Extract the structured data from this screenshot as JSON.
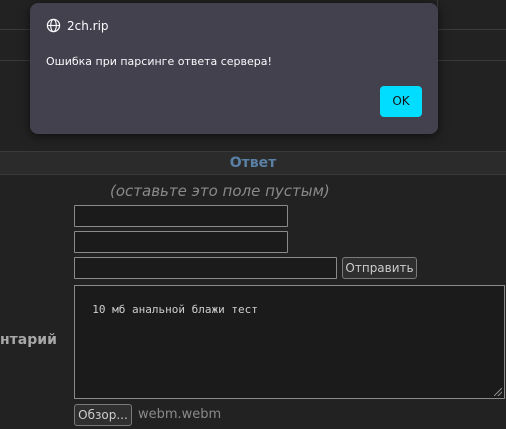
{
  "dialog": {
    "origin": "2ch.rip",
    "message": "Ошибка при парсинге ответа сервера!",
    "ok_label": "OK"
  },
  "form": {
    "section_title": "Ответ",
    "leave_empty_hint": "(оставьте это поле пустым)",
    "field1_value": "",
    "field2_value": "",
    "field3_value": "",
    "submit_label": "Отправить",
    "comment_label": "нтарий",
    "comment_value": "10 мб анальной блажи тест",
    "browse_label": "Обзор...",
    "file_name": "webm.webm"
  },
  "colors": {
    "dialog_bg": "#42414d",
    "ok_accent": "#00ddff",
    "section_title": "#5a80a6",
    "page_bg": "#222222"
  },
  "icons": {
    "origin": "globe-icon",
    "resize": "resize-grip-icon"
  }
}
